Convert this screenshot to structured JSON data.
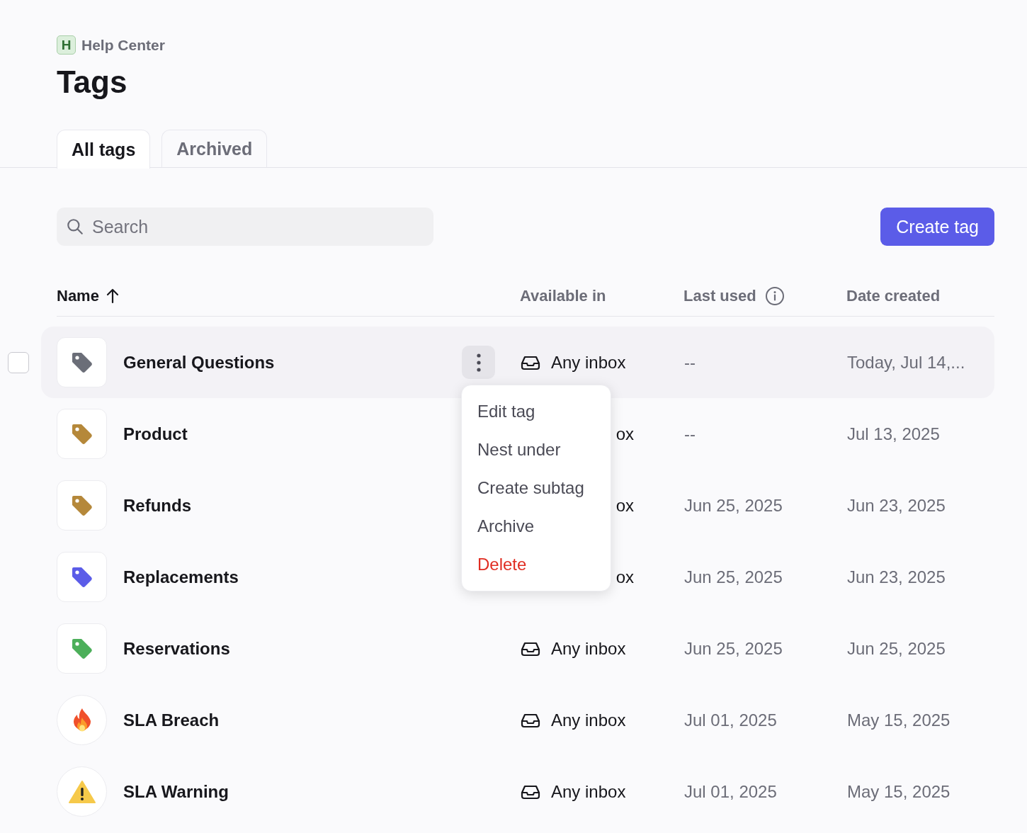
{
  "breadcrumb": {
    "badge": "H",
    "label": "Help Center"
  },
  "title": "Tags",
  "tabs": [
    {
      "label": "All tags",
      "selected": true
    },
    {
      "label": "Archived",
      "selected": false
    }
  ],
  "search": {
    "placeholder": "Search"
  },
  "create_button": "Create tag",
  "table": {
    "columns": [
      {
        "label": "Name",
        "sorted": true
      },
      {
        "label": "Available in"
      },
      {
        "label": "Last used",
        "info": true
      },
      {
        "label": "Date created"
      }
    ],
    "rows": [
      {
        "name": "General Questions",
        "icon": {
          "kind": "tag",
          "color": "#6b6e78"
        },
        "available": {
          "kind": "full",
          "text": "Any inbox"
        },
        "last_used": "--",
        "date_created": "Today, Jul 14,...",
        "hovered": true,
        "checked": false
      },
      {
        "name": "Product",
        "icon": {
          "kind": "tag",
          "color": "#b5883a"
        },
        "available": {
          "kind": "partial",
          "text": "ox"
        },
        "last_used": "--",
        "date_created": "Jul 13, 2025",
        "hovered": false
      },
      {
        "name": "Refunds",
        "icon": {
          "kind": "tag",
          "color": "#b5883a"
        },
        "available": {
          "kind": "partial",
          "text": "ox"
        },
        "last_used": "Jun 25, 2025",
        "date_created": "Jun 23, 2025",
        "hovered": false
      },
      {
        "name": "Replacements",
        "icon": {
          "kind": "tag",
          "color": "#5b5ce8"
        },
        "available": {
          "kind": "partial",
          "text": "ox"
        },
        "last_used": "Jun 25, 2025",
        "date_created": "Jun 23, 2025",
        "hovered": false
      },
      {
        "name": "Reservations",
        "icon": {
          "kind": "tag",
          "color": "#4caf5a"
        },
        "available": {
          "kind": "full",
          "text": "Any inbox"
        },
        "last_used": "Jun 25, 2025",
        "date_created": "Jun 25, 2025",
        "hovered": false
      },
      {
        "name": "SLA Breach",
        "icon": {
          "kind": "fire"
        },
        "available": {
          "kind": "full",
          "text": "Any inbox"
        },
        "last_used": "Jul 01, 2025",
        "date_created": "May 15, 2025",
        "hovered": false
      },
      {
        "name": "SLA Warning",
        "icon": {
          "kind": "warning"
        },
        "available": {
          "kind": "full",
          "text": "Any inbox"
        },
        "last_used": "Jul 01, 2025",
        "date_created": "May 15, 2025",
        "hovered": false
      }
    ]
  },
  "menu": {
    "items": [
      {
        "label": "Edit tag",
        "kind": "normal"
      },
      {
        "label": "Nest under",
        "kind": "normal"
      },
      {
        "label": "Create subtag",
        "kind": "normal"
      },
      {
        "label": "Archive",
        "kind": "normal"
      },
      {
        "label": "Delete",
        "kind": "danger"
      }
    ]
  }
}
